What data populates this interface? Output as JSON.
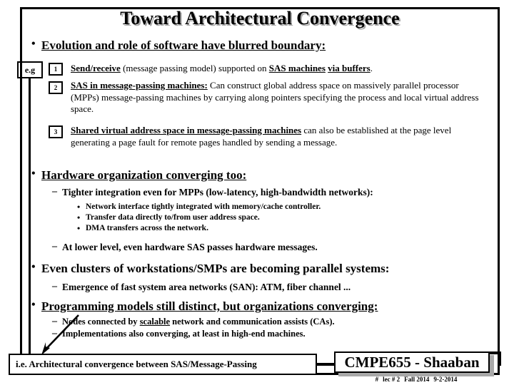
{
  "slide": {
    "title": "Toward Architectural Convergence",
    "sections": {
      "evolution": {
        "heading": "Evolution and role of software have blurred boundary:",
        "eg_label": "e.g",
        "items": [
          {
            "number": "1",
            "lead": "Send/receive",
            "rest": " (message passing model) supported on ",
            "tail_hl": "SAS machines",
            "tail_mid": " ",
            "tail_hl2": "via buffers",
            "tail_end": "."
          },
          {
            "number": "2",
            "lead": "SAS in message-passing machines:",
            "rest": " Can construct global address space on massively parallel processor (MPPs) message-passing machines by carrying along pointers specifying the process and local virtual address space."
          },
          {
            "number": "3",
            "lead": "Shared virtual address space in message-passing machines",
            "rest": " can also be established at the page level generating a page fault for remote pages handled by sending a message."
          }
        ]
      },
      "hardware": {
        "heading": "Hardware organization converging too:",
        "sub1": "Tighter integration even for MPPs (low-latency, high-bandwidth networks):",
        "subsubs": [
          "Network interface tightly integrated with memory/cache controller.",
          "Transfer data directly to/from user address space.",
          "DMA transfers across the network."
        ],
        "sub2": "At lower level, even hardware SAS passes hardware messages."
      },
      "clusters": {
        "heading": "Even clusters of workstations/SMPs are becoming parallel systems:",
        "sub1": "Emergence of fast system area networks (SAN):  ATM, fiber channel ..."
      },
      "programming": {
        "heading": "Programming models still distinct, but organizations converging:",
        "sub1_pre": "Nodes connected by ",
        "sub1_hl": "scalable",
        "sub1_post": " network and communication assists (CAs).",
        "sub2": "Implementations also converging, at least in high-end machines."
      }
    },
    "footer": {
      "note": "i.e. Architectural convergence between SAS/Message-Passing",
      "course": "CMPE655 - Shaaban",
      "meta_hash": "#",
      "meta_lec": "lec # 2",
      "meta_term": "Fall 2014",
      "meta_date": "9-2-2014"
    },
    "bullets": {
      "dot": "•",
      "dash": "–",
      "small_dot": "•"
    },
    "colors": {
      "text": "#000000",
      "shadow": "#a8a8a8",
      "background": "#ffffff"
    }
  }
}
